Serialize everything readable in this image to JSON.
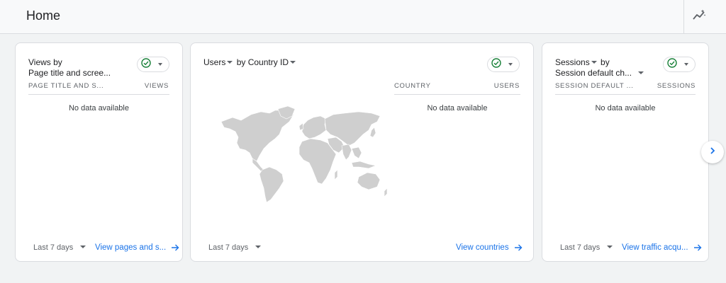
{
  "header": {
    "title": "Home"
  },
  "icons": {
    "insights": "insights-icon",
    "status": "check-circle-icon",
    "next": "chevron-right-icon",
    "link_arrow": "arrow-right-icon"
  },
  "colors": {
    "status_green": "#188038",
    "link_blue": "#1a73e8",
    "map_gray": "#cfcfcf"
  },
  "cards": [
    {
      "title_line1": "Views by",
      "title_line2": "Page title and scree...",
      "col1": "PAGE TITLE AND S...",
      "col2": "VIEWS",
      "empty": "No data available",
      "date_range": "Last 7 days",
      "link": "View pages and s..."
    },
    {
      "title_metric": "Users",
      "title_by": "by Country ID",
      "col1": "COUNTRY",
      "col2": "USERS",
      "empty": "No data available",
      "date_range": "Last 7 days",
      "link": "View countries"
    },
    {
      "title_metric": "Sessions",
      "title_by": "by",
      "title_line2": "Session default ch...",
      "col1": "SESSION DEFAULT ...",
      "col2": "SESSIONS",
      "empty": "No data available",
      "date_range": "Last 7 days",
      "link": "View traffic acqu..."
    }
  ]
}
